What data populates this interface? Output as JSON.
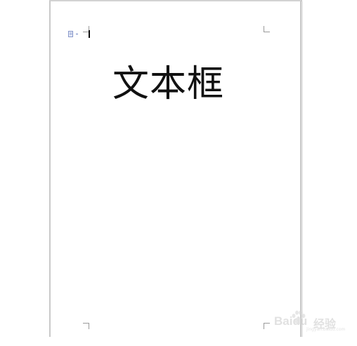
{
  "document": {
    "text_box_content": "文本框"
  },
  "watermark": {
    "brand": "Baidu",
    "suffix": "经验",
    "sub": "jingyan.baidu.com"
  },
  "colors": {
    "page": "#ffffff",
    "page_border": "#c9c9c9",
    "corner_marks": "#9a9a9a",
    "text": "#111111",
    "anchor_icon": "#6b7fbf"
  },
  "icons": {
    "anchor": "anchor-icon",
    "watermark_logo": "paw-icon"
  }
}
